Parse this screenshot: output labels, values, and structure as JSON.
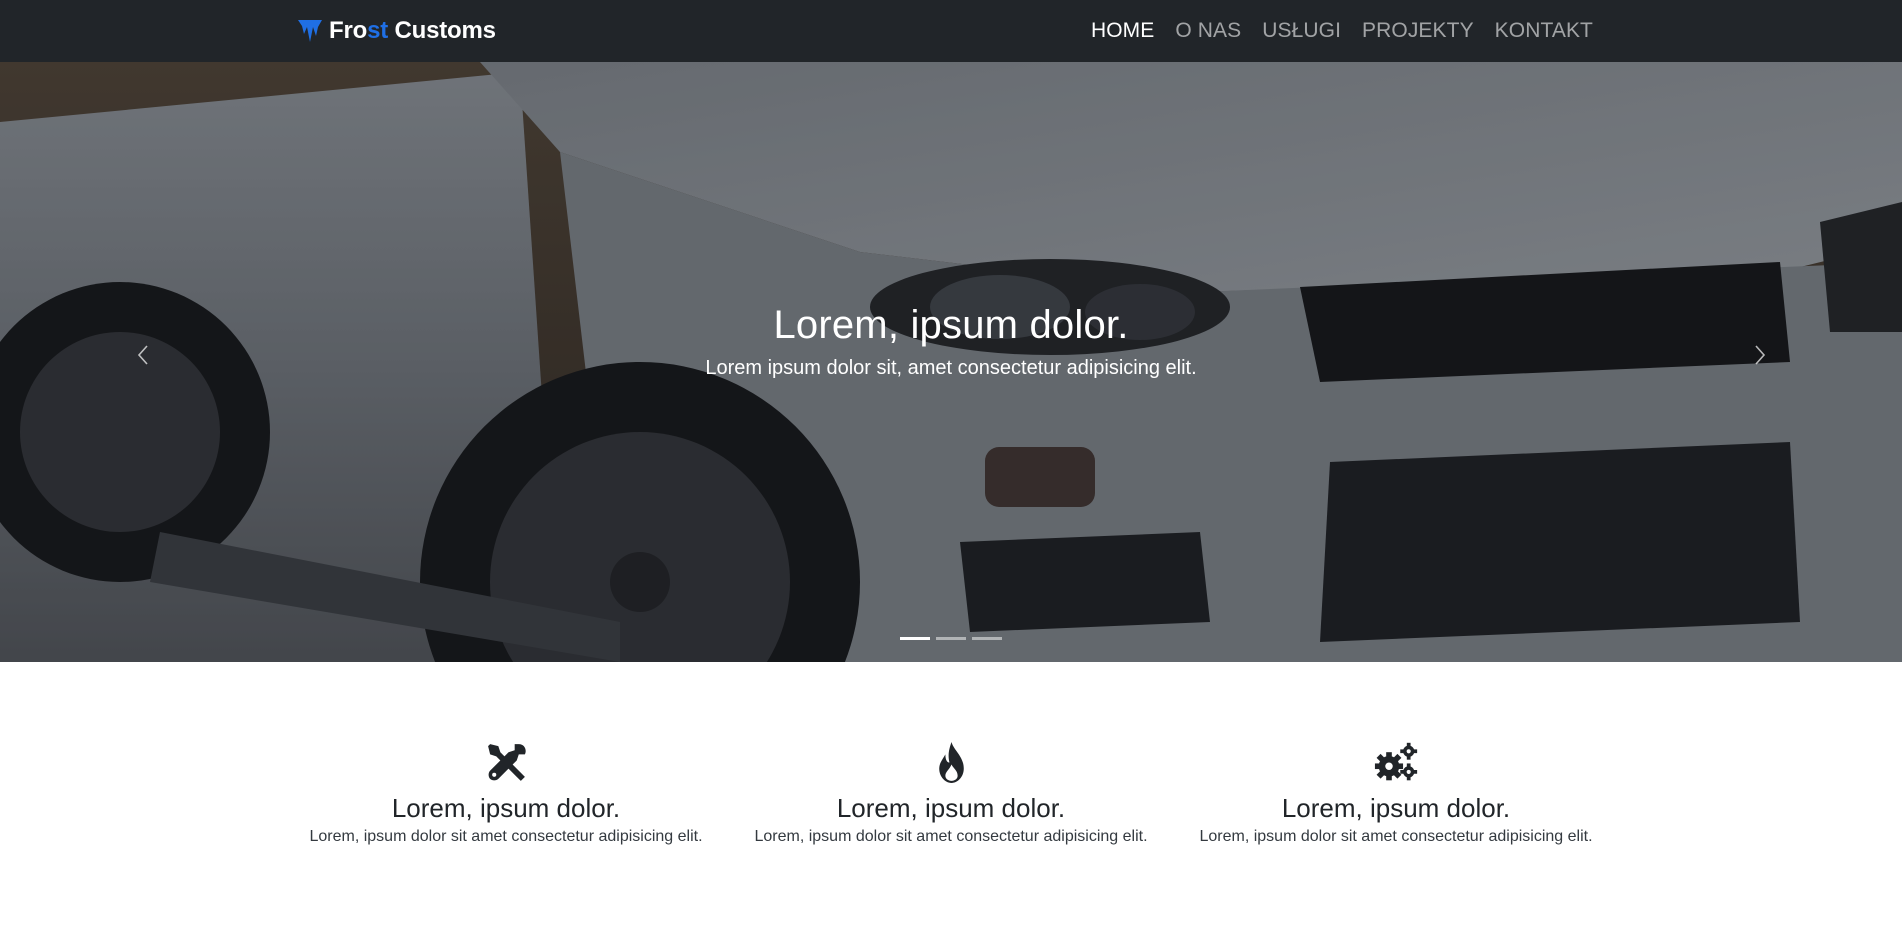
{
  "navbar": {
    "brand": {
      "part1": "Fro",
      "part2": "st",
      "part3": " Customs",
      "icon": "icicle-logo-icon",
      "accent_color": "#1f6fe5"
    },
    "items": [
      {
        "label": "HOME",
        "active": true
      },
      {
        "label": "O NAS",
        "active": false
      },
      {
        "label": "USŁUGI",
        "active": false
      },
      {
        "label": "PROJEKTY",
        "active": false
      },
      {
        "label": "KONTAKT",
        "active": false
      }
    ],
    "background": "#212529"
  },
  "hero": {
    "title": "Lorem, ipsum dolor.",
    "subtitle": "Lorem ipsum dolor sit, amet consectetur adipisicing elit.",
    "image": "silver-sports-car-photo",
    "prev_icon": "chevron-left-icon",
    "next_icon": "chevron-right-icon",
    "slides_count": 3,
    "active_slide": 1
  },
  "features": [
    {
      "icon": "tools-icon",
      "title": "Lorem, ipsum dolor.",
      "text": "Lorem, ipsum dolor sit amet consectetur adipisicing elit."
    },
    {
      "icon": "fire-icon",
      "title": "Lorem, ipsum dolor.",
      "text": "Lorem, ipsum dolor sit amet consectetur adipisicing elit."
    },
    {
      "icon": "cogs-icon",
      "title": "Lorem, ipsum dolor.",
      "text": "Lorem, ipsum dolor sit amet consectetur adipisicing elit."
    }
  ]
}
